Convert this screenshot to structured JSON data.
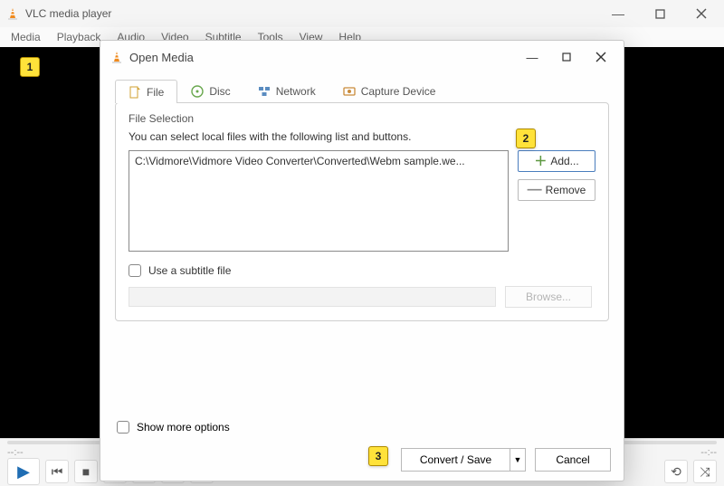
{
  "main_window": {
    "title": "VLC media player",
    "menus": [
      "Media",
      "Playback",
      "Audio",
      "Video",
      "Subtitle",
      "Tools",
      "View",
      "Help"
    ],
    "time_left": "--:--",
    "time_right": "--:--",
    "callout_1": "1"
  },
  "dialog": {
    "title": "Open Media",
    "tabs": {
      "file": "File",
      "disc": "Disc",
      "network": "Network",
      "capture": "Capture Device"
    },
    "file_section": {
      "title": "File Selection",
      "hint": "You can select local files with the following list and buttons.",
      "selected_path": "C:\\Vidmore\\Vidmore Video Converter\\Converted\\Webm sample.we...",
      "add_label": "Add...",
      "remove_label": "Remove",
      "callout_2": "2"
    },
    "subtitle": {
      "checkbox_label": "Use a subtitle file",
      "browse_label": "Browse..."
    },
    "more_options_label": "Show more options",
    "convert_label": "Convert / Save",
    "cancel_label": "Cancel",
    "callout_3": "3"
  }
}
